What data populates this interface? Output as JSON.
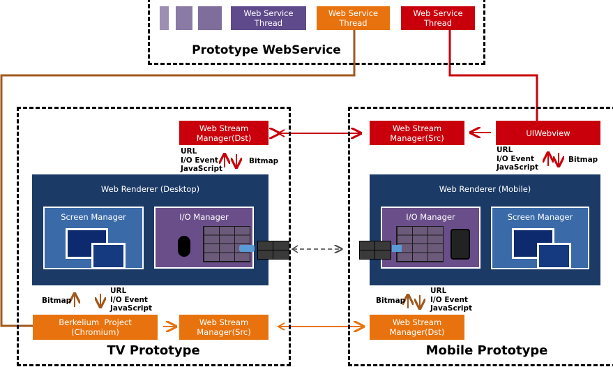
{
  "webservice": {
    "title": "Prototype WebService",
    "threads": [
      {
        "label": "Web Service\nThread",
        "color": "#5f4a8b"
      },
      {
        "label": "Web Service\nThread",
        "color": "#e8730e"
      },
      {
        "label": "Web Service\nThread",
        "color": "#c9000b"
      }
    ]
  },
  "tv": {
    "title": "TV Prototype",
    "wsm_dst": "Web Stream\nManager(Dst)",
    "top_labels": "URL\nI/O Event\nJavaScript",
    "top_bitmap": "Bitmap",
    "renderer_title": "Web Renderer  (Desktop)",
    "screen_manager": "Screen Manager",
    "io_manager": "I/O Manager",
    "bottom_bitmap": "Bitmap",
    "bottom_labels": "URL\nI/O Event\nJavaScript",
    "berkelium": "Berkelium  Project\n(Chromium)",
    "wsm_src": "Web Stream\nManager(Src)"
  },
  "mobile": {
    "title": "Mobile Prototype",
    "wsm_src": "Web Stream\nManager(Src)",
    "uiwebview": "UIWebview",
    "top_labels": "URL\nI/O Event\nJavaScript",
    "top_bitmap": "Bitmap",
    "renderer_title": "Web Renderer  (Mobile)",
    "io_manager": "I/O Manager",
    "screen_manager": "Screen Manager",
    "bottom_bitmap": "Bitmap",
    "bottom_labels": "URL\nI/O Event\nJavaScript",
    "wsm_dst": "Web Stream\nManager(Dst)"
  },
  "colors": {
    "red": "#c9000b",
    "orange": "#e8730e",
    "brown": "#a0581c",
    "navy": "#1b3a66",
    "purple": "#6a4e8a",
    "blue": "#3a6aa8"
  }
}
